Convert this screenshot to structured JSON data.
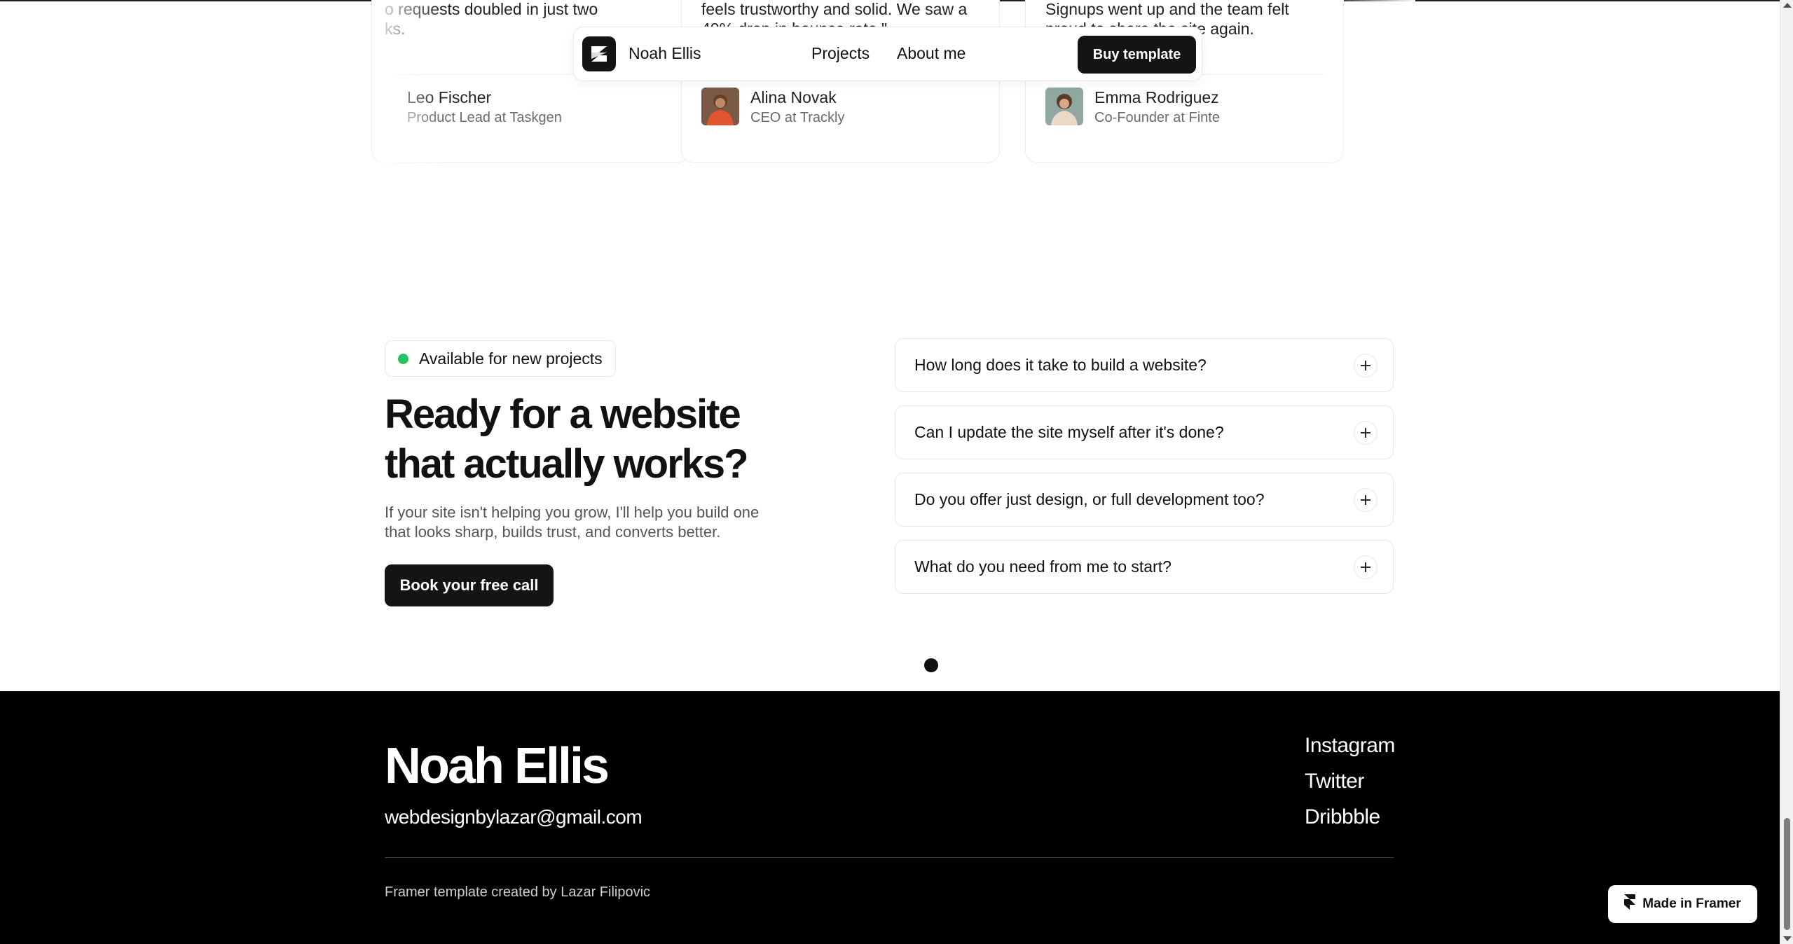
{
  "nav": {
    "brand": "Noah Ellis",
    "links": [
      "Projects",
      "About me"
    ],
    "buy_label": "Buy template"
  },
  "testimonials": [
    {
      "quote_lines": [
        "o requests doubled in just two",
        "ks."
      ],
      "name": "Leo Fischer",
      "role": "Product Lead at Taskgen"
    },
    {
      "quote_lines": [
        "feels trustworthy and solid. We saw a",
        "40% drop in bounce rate.\""
      ],
      "name": "Alina Novak",
      "role": "CEO at Trackly"
    },
    {
      "quote_lines": [
        "Signups went up and the team felt",
        "proud to share the site again."
      ],
      "name": "Emma Rodriguez",
      "role": "Co-Founder at Finte"
    }
  ],
  "cta": {
    "badge": "Available for new projects",
    "headline_lines": [
      "Ready for a website",
      "that actually works?"
    ],
    "sub_lines": [
      "If your site isn't helping you grow, I'll help you build one",
      "that looks sharp, builds trust, and converts better."
    ],
    "button": "Book your free call"
  },
  "faq": [
    "How long does it take to build a website?",
    "Can I update the site myself after it's done?",
    "Do you offer just design, or full development too?",
    "What do you need from me to start?"
  ],
  "footer": {
    "name": "Noah Ellis",
    "email": "webdesignbylazar@gmail.com",
    "social": [
      "Instagram",
      "Twitter",
      "Dribbble"
    ],
    "credit": "Framer template created by Lazar Filipovic"
  },
  "framer_badge": "Made in Framer",
  "colors": {
    "accent_dark": "#141414",
    "available_dot": "#22c55e",
    "footer_bg": "#000000"
  },
  "icons": {
    "logo": "brand-logo-icon",
    "faq_toggle": "plus-icon",
    "framer": "framer-logo-icon"
  }
}
